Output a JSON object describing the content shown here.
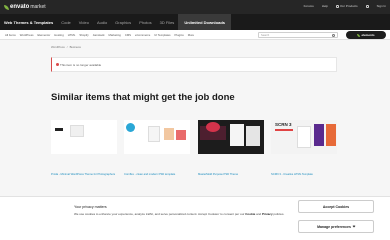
{
  "brand": {
    "name": "envato",
    "suffix": "market"
  },
  "top_actions": {
    "forum": "Forums",
    "help": "Help",
    "our_products": "Our Products",
    "sign_in": "Sign In"
  },
  "categories": [
    {
      "label": "Web Themes & Templates",
      "active": false,
      "first": true
    },
    {
      "label": "Code",
      "active": false
    },
    {
      "label": "Video",
      "active": false
    },
    {
      "label": "Audio",
      "active": false
    },
    {
      "label": "Graphics",
      "active": false
    },
    {
      "label": "Photos",
      "active": false
    },
    {
      "label": "3D Files",
      "active": false
    },
    {
      "label": "Unlimited Downloads",
      "active": true
    }
  ],
  "subnav": [
    "All Items",
    "WordPress",
    "Elementor",
    "Hosting",
    "HTML",
    "Shopify",
    "Jamstack",
    "Marketing",
    "CMS",
    "eCommerce",
    "UI Templates",
    "Plugins",
    "More"
  ],
  "search": {
    "placeholder": "Search"
  },
  "elements_pill": "elements",
  "breadcrumb": [
    "WordPress",
    "/",
    "Business"
  ],
  "notice": "This item is no longer available",
  "heading": "Similar items that might get the job done",
  "cards": [
    {
      "title": "Proda - Minimal WordPress Theme for Photographers"
    },
    {
      "title": "Cornflex - clean and modern PSD template"
    },
    {
      "title": "MasterMold Purpose PSD Theme"
    },
    {
      "title": "SCRN 3 - Creative HTML Template"
    }
  ],
  "card_t4_label": "SCRN 3",
  "cookie": {
    "title": "Your privacy matters",
    "body_1": "We use cookies to enhance your experience, analyze traffic, and serve personalized content. Accept Cookies' to consent per our ",
    "cookie_link": "Cookie",
    "and": " and ",
    "privacy_link": "Privacy",
    "body_2": " policies.",
    "accept": "Accept Cookies",
    "manage": "Manage preferences"
  }
}
